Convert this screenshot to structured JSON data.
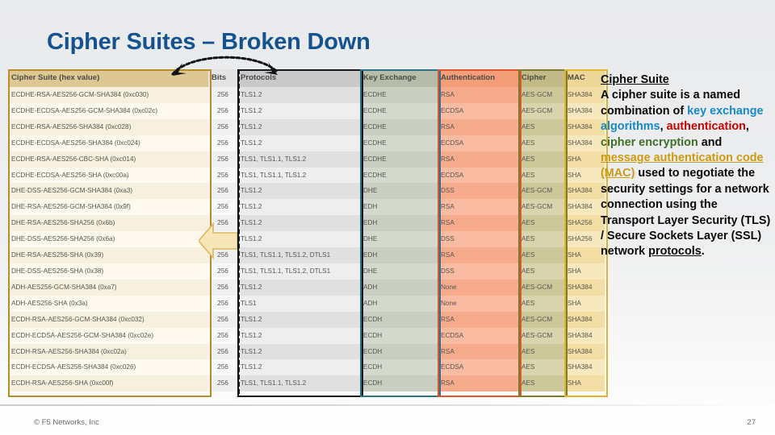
{
  "slide": {
    "title": "Cipher Suites – Broken Down"
  },
  "footer": {
    "copyright": "© F5 Networks, Inc",
    "page_number": "27"
  },
  "table": {
    "headers": {
      "suite": "Cipher Suite (hex value)",
      "bits": "Bits",
      "protocols": "Protocols",
      "key_exchange": "Key Exchange",
      "authentication": "Authentication",
      "cipher": "Cipher",
      "mac": "MAC"
    },
    "group_outline_colors": {
      "suite": "#b98d25",
      "protocols": "#15181c",
      "key_exchange": "#2d7287",
      "authentication": "#e2542a",
      "cipher": "#7d7b2e",
      "mac": "#e0b52c"
    },
    "rows": [
      {
        "suite": "ECDHE-RSA-AES256-GCM-SHA384 (0xc030)",
        "bits": "256",
        "protocols": "TLS1.2",
        "kx": "ECDHE",
        "auth": "RSA",
        "cipher": "AES-GCM",
        "mac": "SHA384"
      },
      {
        "suite": "ECDHE-ECDSA-AES256-GCM-SHA384 (0xc02c)",
        "bits": "256",
        "protocols": "TLS1.2",
        "kx": "ECDHE",
        "auth": "ECDSA",
        "cipher": "AES-GCM",
        "mac": "SHA384"
      },
      {
        "suite": "ECDHE-RSA-AES256-SHA384 (0xc028)",
        "bits": "256",
        "protocols": "TLS1.2",
        "kx": "ECDHE",
        "auth": "RSA",
        "cipher": "AES",
        "mac": "SHA384"
      },
      {
        "suite": "ECDHE-ECDSA-AES256-SHA384 (0xc024)",
        "bits": "256",
        "protocols": "TLS1.2",
        "kx": "ECDHE",
        "auth": "ECDSA",
        "cipher": "AES",
        "mac": "SHA384"
      },
      {
        "suite": "ECDHE-RSA-AES256-CBC-SHA (0xc014)",
        "bits": "256",
        "protocols": "TLS1, TLS1.1, TLS1.2",
        "kx": "ECDHE",
        "auth": "RSA",
        "cipher": "AES",
        "mac": "SHA"
      },
      {
        "suite": "ECDHE-ECDSA-AES256-SHA (0xc00a)",
        "bits": "256",
        "protocols": "TLS1, TLS1.1, TLS1.2",
        "kx": "ECDHE",
        "auth": "ECDSA",
        "cipher": "AES",
        "mac": "SHA"
      },
      {
        "suite": "DHE-DSS-AES256-GCM-SHA384 (0xa3)",
        "bits": "256",
        "protocols": "TLS1.2",
        "kx": "DHE",
        "auth": "DSS",
        "cipher": "AES-GCM",
        "mac": "SHA384"
      },
      {
        "suite": "DHE-RSA-AES256-GCM-SHA384 (0x9f)",
        "bits": "256",
        "protocols": "TLS1.2",
        "kx": "EDH",
        "auth": "RSA",
        "cipher": "AES-GCM",
        "mac": "SHA384"
      },
      {
        "suite": "DHE-RSA-AES256-SHA256 (0x6b)",
        "bits": "256",
        "protocols": "TLS1.2",
        "kx": "EDH",
        "auth": "RSA",
        "cipher": "AES",
        "mac": "SHA256"
      },
      {
        "suite": "DHE-DSS-AES256-SHA256 (0x6a)",
        "bits": "256",
        "protocols": "TLS1.2",
        "kx": "DHE",
        "auth": "DSS",
        "cipher": "AES",
        "mac": "SHA256"
      },
      {
        "suite": "DHE-RSA-AES256-SHA (0x39)",
        "bits": "256",
        "protocols": "TLS1, TLS1.1, TLS1.2, DTLS1",
        "kx": "EDH",
        "auth": "RSA",
        "cipher": "AES",
        "mac": "SHA"
      },
      {
        "suite": "DHE-DSS-AES256-SHA (0x38)",
        "bits": "256",
        "protocols": "TLS1, TLS1.1, TLS1.2, DTLS1",
        "kx": "DHE",
        "auth": "DSS",
        "cipher": "AES",
        "mac": "SHA"
      },
      {
        "suite": "ADH-AES256-GCM-SHA384 (0xa7)",
        "bits": "256",
        "protocols": "TLS1.2",
        "kx": "ADH",
        "auth": "None",
        "cipher": "AES-GCM",
        "mac": "SHA384"
      },
      {
        "suite": "ADH-AES256-SHA (0x3a)",
        "bits": "256",
        "protocols": "TLS1",
        "kx": "ADH",
        "auth": "None",
        "cipher": "AES",
        "mac": "SHA"
      },
      {
        "suite": "ECDH-RSA-AES256-GCM-SHA384 (0xc032)",
        "bits": "256",
        "protocols": "TLS1.2",
        "kx": "ECDH",
        "auth": "RSA",
        "cipher": "AES-GCM",
        "mac": "SHA384"
      },
      {
        "suite": "ECDH-ECDSA-AES256-GCM-SHA384 (0xc02e)",
        "bits": "256",
        "protocols": "TLS1.2",
        "kx": "ECDH",
        "auth": "ECDSA",
        "cipher": "AES-GCM",
        "mac": "SHA384"
      },
      {
        "suite": "ECDH-RSA-AES256-SHA384 (0xc02a)",
        "bits": "256",
        "protocols": "TLS1.2",
        "kx": "ECDH",
        "auth": "RSA",
        "cipher": "AES",
        "mac": "SHA384"
      },
      {
        "suite": "ECDH-ECDSA-AES256-SHA384 (0xc026)",
        "bits": "256",
        "protocols": "TLS1.2",
        "kx": "ECDH",
        "auth": "ECDSA",
        "cipher": "AES",
        "mac": "SHA384"
      },
      {
        "suite": "ECDH-RSA-AES256-SHA (0xc00f)",
        "bits": "256",
        "protocols": "TLS1, TLS1.1, TLS1.2",
        "kx": "ECDH",
        "auth": "RSA",
        "cipher": "AES",
        "mac": "SHA"
      }
    ]
  },
  "panel": {
    "heading": "Cipher Suite",
    "text_1": "A cipher suite is a named combination of ",
    "term_key_exchange": "key exchange algorithms",
    "sep_1": ", ",
    "term_authentication": "authentication",
    "sep_2": ", ",
    "term_cipher": "cipher encryption",
    "text_2": " and ",
    "term_mac": "message authentication code (MAC)",
    "text_3": " used to negotiate the security settings for a network connection using the Transport Layer Security (TLS) / Secure Sockets Layer (SSL) network ",
    "term_protocols": "protocols",
    "text_4": ".",
    "colors": {
      "key_exchange": "#1689c8",
      "authentication": "#cc0000",
      "cipher": "#3f7028",
      "mac": "#cc9a11"
    }
  }
}
